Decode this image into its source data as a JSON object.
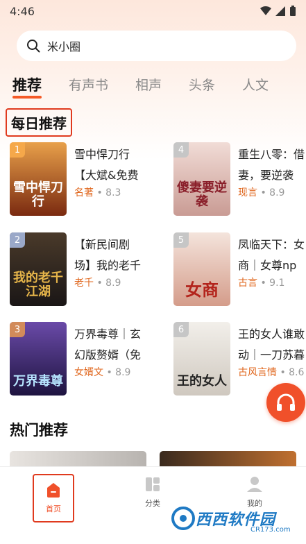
{
  "status": {
    "time": "4:46"
  },
  "search": {
    "value": "米小圈"
  },
  "tabs": [
    {
      "label": "推荐",
      "active": true
    },
    {
      "label": "有声书"
    },
    {
      "label": "相声"
    },
    {
      "label": "头条"
    },
    {
      "label": "人文"
    }
  ],
  "section": {
    "daily": "每日推荐",
    "hot": "热门推荐"
  },
  "books": [
    {
      "rank": "1",
      "title": "雪中悍刀行",
      "subtitle": "【大斌&免费",
      "tag": "名著",
      "score": "8.3",
      "cover_text": "雪中悍刀行",
      "cover_color": "#b4461e"
    },
    {
      "rank": "4",
      "title": "重生八零：借",
      "subtitle": "妻，要逆袭",
      "tag": "现言",
      "score": "8.9",
      "cover_text": "傻妻要逆袭",
      "cover_color": "#d9b7b0"
    },
    {
      "rank": "2",
      "title": "【新民间剧",
      "subtitle": "场】我的老千",
      "tag": "老千",
      "score": "8.9",
      "cover_text": "我的老千江湖",
      "cover_color": "#2c2a2a"
    },
    {
      "rank": "5",
      "title": "凤临天下：女",
      "subtitle": "商｜女尊np",
      "tag": "古言",
      "score": "9.1",
      "cover_text": "女商",
      "cover_color": "#e8c6b8"
    },
    {
      "rank": "3",
      "title": "万界毒尊｜玄",
      "subtitle": "幻版赘婿（免",
      "tag": "女婿文",
      "score": "8.9",
      "cover_text": "万界毒尊",
      "cover_color": "#3a2a6a"
    },
    {
      "rank": "6",
      "title": "王的女人谁敢",
      "subtitle": "动｜一刀苏暮",
      "tag": "古风言情",
      "score": "8.6",
      "cover_text": "王的女人",
      "cover_color": "#e6e2dc"
    }
  ],
  "nav": [
    {
      "label": "首页",
      "active": true
    },
    {
      "label": "分类"
    },
    {
      "label": "我的"
    }
  ],
  "watermark": {
    "brand": "西西软件园",
    "url": "CR173.com"
  },
  "colors": {
    "accent": "#f0502a",
    "highlight_box": "#e03a1e",
    "tag": "#e0671e"
  },
  "icons": {
    "search": "search-icon",
    "audio": "headphones-icon",
    "home": "home-icon",
    "category": "grid-icon",
    "profile": "user-icon"
  }
}
